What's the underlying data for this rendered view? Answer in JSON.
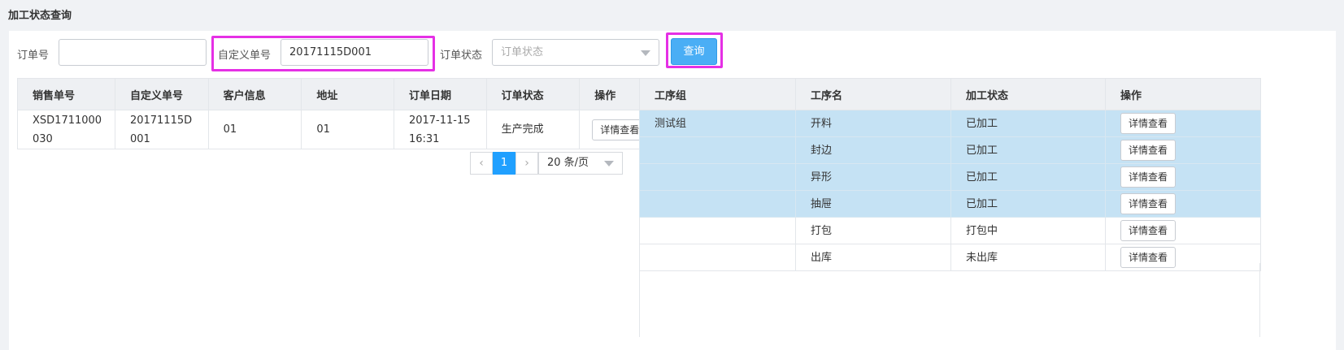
{
  "page_title": "加工状态查询",
  "filters": {
    "order_no_label": "订单号",
    "order_no_value": "",
    "custom_no_label": "自定义单号",
    "custom_no_value": "20171115D001",
    "status_label": "订单状态",
    "status_placeholder": "订单状态",
    "query_button": "查询"
  },
  "left_table": {
    "columns": [
      "销售单号",
      "自定义单号",
      "客户信息",
      "地址",
      "订单日期",
      "订单状态",
      "操作"
    ],
    "rows": [
      {
        "sales_no_line1": "XSD1711000",
        "sales_no_line2": "030",
        "custom_no_line1": "20171115D",
        "custom_no_line2": "001",
        "customer": "01",
        "address": "01",
        "date_line1": "2017-11-15",
        "date_line2": "16:31",
        "status": "生产完成",
        "action": "详情查看"
      }
    ]
  },
  "pagination": {
    "prev_icon": "‹",
    "current_page": "1",
    "next_icon": "›",
    "page_size": "20 条/页"
  },
  "right_table": {
    "columns": [
      "工序组",
      "工序名",
      "加工状态",
      "操作"
    ],
    "rows": [
      {
        "group": "测试组",
        "name": "开料",
        "status": "已加工",
        "action": "详情查看"
      },
      {
        "group": "",
        "name": "封边",
        "status": "已加工",
        "action": "详情查看"
      },
      {
        "group": "",
        "name": "异形",
        "status": "已加工",
        "action": "详情查看"
      },
      {
        "group": "",
        "name": "抽屉",
        "status": "已加工",
        "action": "详情查看"
      },
      {
        "group": "",
        "name": "打包",
        "status": "打包中",
        "action": "详情查看"
      },
      {
        "group": "",
        "name": "出库",
        "status": "未出库",
        "action": "详情查看"
      }
    ]
  }
}
